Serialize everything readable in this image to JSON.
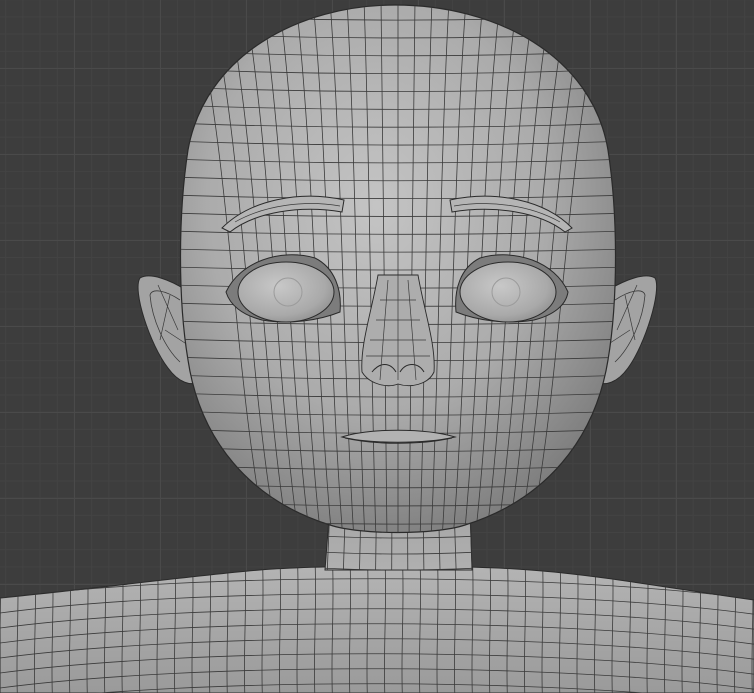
{
  "viewport": {
    "background_color": "#3d3d3d",
    "grid_major_color": "#4a4a4a",
    "grid_minor_color": "#434343",
    "mesh_surface_color": "#a6a6a6",
    "wireframe_color": "#2a2a2a",
    "shading": "solid",
    "overlay": "wireframe"
  },
  "model": {
    "name_icon": "character-head-mesh-icon"
  }
}
